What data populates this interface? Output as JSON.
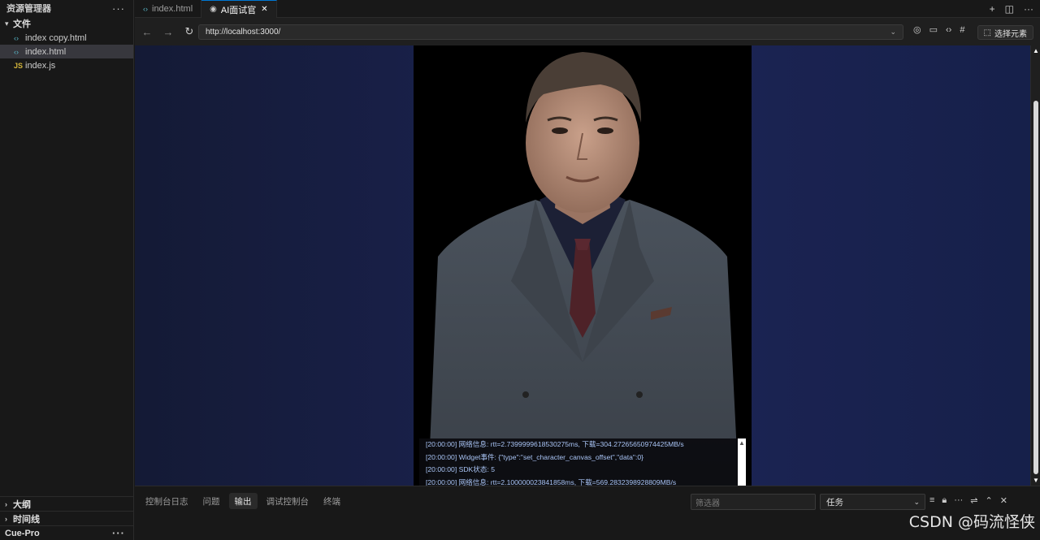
{
  "sidebar": {
    "title": "资源管理器",
    "more": "···",
    "section_files": "文件",
    "files": [
      {
        "icon": "‹›",
        "name": "index copy.html"
      },
      {
        "icon": "‹›",
        "name": "index.html"
      },
      {
        "icon": "JS",
        "name": "index.js"
      }
    ],
    "outline": "大纲",
    "timeline": "时间线",
    "bottom_item": "Cue-Pro",
    "bottom_more": "···"
  },
  "tabs": [
    {
      "icon": "‹›",
      "label": "index.html"
    },
    {
      "icon": "◉",
      "label": "AI面试官",
      "close": "✕"
    }
  ],
  "browser": {
    "url": "http://localhost:3000/",
    "select_element": "选择元素"
  },
  "log": {
    "lines": [
      "[20:00:00] 网络信息: rtt=2.7399999618530275ms, 下载=304.27265650974425MB/s",
      "[20:00:00] Widget事件: {\"type\":\"set_character_canvas_offset\",\"data\":0}",
      "[20:00:00] SDK状态: 5",
      "[20:00:00] 网络信息: rtt=2.100000023841858ms, 下载=569.2832398928809MB/s"
    ]
  },
  "panel": {
    "tabs": [
      "控制台日志",
      "问题",
      "输出",
      "调试控制台",
      "终端"
    ],
    "active_tab": "输出",
    "filter_placeholder": "筛选器",
    "task_select": "任务"
  },
  "watermark": "CSDN @码流怪侠",
  "colors": {
    "accent": "#0078d4",
    "page_bg": "#1a2250",
    "log_text": "#a9c4f5"
  }
}
